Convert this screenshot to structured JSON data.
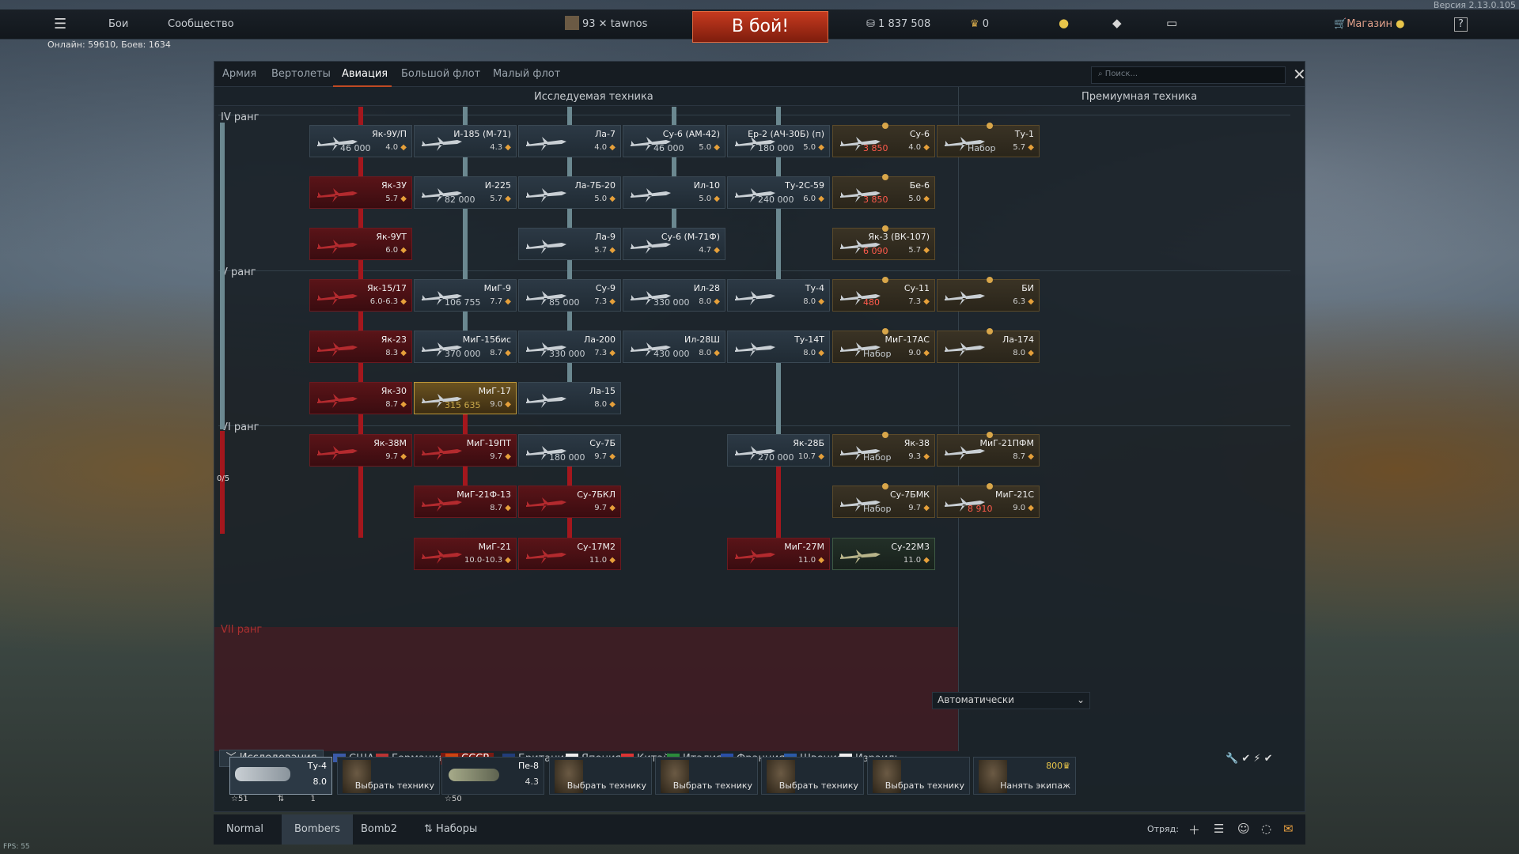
{
  "version": "Версия 2.13.0.105",
  "top": {
    "battles": "Бои",
    "community": "Сообщество",
    "level": "93",
    "player": "tawnos",
    "battle_btn": "В бой!",
    "silver": "1 837 508",
    "gold": "0",
    "shop": "Магазин",
    "help": "?"
  },
  "online": "Онлайн: 59610, Боев: 1634",
  "tabs": [
    "Армия",
    "Вертолеты",
    "Авиация",
    "Большой флот",
    "Малый флот"
  ],
  "search_placeholder": "Поиск...",
  "headers": {
    "research": "Исследуемая техника",
    "premium": "Премиумная техника"
  },
  "ranks": [
    "IV ранг",
    "V ранг",
    "VI ранг",
    "VII ранг"
  ],
  "rank_progress": "0/5",
  "cards": [
    {
      "n": "Як-9У/П",
      "rp": "46 000",
      "br": "4.0",
      "s": "std"
    },
    {
      "n": "И-185 (М-71)",
      "rp": "",
      "br": "4.3",
      "s": "std"
    },
    {
      "n": "Ла-7",
      "rp": "",
      "br": "4.0",
      "s": "std"
    },
    {
      "n": "Су-6 (АМ-42)",
      "rp": "46 000",
      "br": "5.0",
      "s": "std"
    },
    {
      "n": "Ер-2 (АЧ-30Б) (п)",
      "rp": "180 000",
      "br": "5.0",
      "s": "std"
    },
    {
      "n": "Як-3У",
      "rp": "",
      "br": "5.7",
      "s": "red"
    },
    {
      "n": "И-225",
      "rp": "82 000",
      "br": "5.7",
      "s": "std"
    },
    {
      "n": "Ла-7Б-20",
      "rp": "",
      "br": "5.0",
      "s": "std"
    },
    {
      "n": "Ил-10",
      "rp": "",
      "br": "5.0",
      "s": "std"
    },
    {
      "n": "Ту-2С-59",
      "rp": "240 000",
      "br": "6.0",
      "s": "std"
    },
    {
      "n": "Як-9УТ",
      "rp": "",
      "br": "6.0",
      "s": "red"
    },
    {
      "n": "Ла-9",
      "rp": "",
      "br": "5.7",
      "s": "std"
    },
    {
      "n": "Су-6 (М-71Ф)",
      "rp": "",
      "br": "4.7",
      "s": "std"
    },
    {
      "n": "Як-15/17",
      "rp": "",
      "br": "6.0-6.3",
      "s": "red"
    },
    {
      "n": "МиГ-9",
      "rp": "106 755",
      "br": "7.7",
      "s": "std"
    },
    {
      "n": "Су-9",
      "rp": "85 000",
      "br": "7.3",
      "s": "std"
    },
    {
      "n": "Ил-28",
      "rp": "330 000",
      "br": "8.0",
      "s": "std"
    },
    {
      "n": "Ту-4",
      "rp": "",
      "br": "8.0",
      "s": "std"
    },
    {
      "n": "Як-23",
      "rp": "",
      "br": "8.3",
      "s": "red"
    },
    {
      "n": "МиГ-15бис",
      "rp": "370 000",
      "br": "8.7",
      "s": "std"
    },
    {
      "n": "Ла-200",
      "rp": "330 000",
      "br": "7.3",
      "s": "std"
    },
    {
      "n": "Ил-28Ш",
      "rp": "430 000",
      "br": "8.0",
      "s": "std"
    },
    {
      "n": "Ту-14Т",
      "rp": "",
      "br": "8.0",
      "s": "std"
    },
    {
      "n": "Як-30",
      "rp": "",
      "br": "8.7",
      "s": "red"
    },
    {
      "n": "МиГ-17",
      "rp": "315 635",
      "br": "9.0",
      "s": "gold"
    },
    {
      "n": "Ла-15",
      "rp": "",
      "br": "8.0",
      "s": "std"
    },
    {
      "n": "Як-38М",
      "rp": "",
      "br": "9.7",
      "s": "red"
    },
    {
      "n": "МиГ-19ПТ",
      "rp": "",
      "br": "9.7",
      "s": "red"
    },
    {
      "n": "Су-7Б",
      "rp": "180 000",
      "br": "9.7",
      "s": "std"
    },
    {
      "n": "Як-28Б",
      "rp": "270 000",
      "br": "10.7",
      "s": "std"
    },
    {
      "n": "МиГ-21Ф-13",
      "rp": "",
      "br": "8.7",
      "s": "red"
    },
    {
      "n": "Су-7БКЛ",
      "rp": "",
      "br": "9.7",
      "s": "red"
    },
    {
      "n": "МиГ-21",
      "rp": "",
      "br": "10.0-10.3",
      "s": "red"
    },
    {
      "n": "Су-17М2",
      "rp": "",
      "br": "11.0",
      "s": "red"
    },
    {
      "n": "МиГ-27М",
      "rp": "",
      "br": "11.0",
      "s": "red"
    },
    {
      "n": "Су-6",
      "rp": "3 850",
      "br": "4.0",
      "s": "prem"
    },
    {
      "n": "Ту-1",
      "rp": "Набор",
      "br": "5.7",
      "s": "prem"
    },
    {
      "n": "Бе-6",
      "rp": "3 850",
      "br": "5.0",
      "s": "prem"
    },
    {
      "n": "Як-3 (ВК-107)",
      "rp": "6 090",
      "br": "5.7",
      "s": "prem"
    },
    {
      "n": "Су-11",
      "rp": "480",
      "br": "7.3",
      "s": "prem"
    },
    {
      "n": "БИ",
      "rp": "",
      "br": "6.3",
      "s": "prem"
    },
    {
      "n": "МиГ-17АС",
      "rp": "Набор",
      "br": "9.0",
      "s": "prem"
    },
    {
      "n": "Ла-174",
      "rp": "",
      "br": "8.0",
      "s": "prem"
    },
    {
      "n": "Як-38",
      "rp": "Набор",
      "br": "9.3",
      "s": "prem"
    },
    {
      "n": "МиГ-21ПФМ",
      "rp": "",
      "br": "8.7",
      "s": "prem"
    },
    {
      "n": "Су-7БМК",
      "rp": "Набор",
      "br": "9.7",
      "s": "prem"
    },
    {
      "n": "МиГ-21С",
      "rp": "8 910",
      "br": "9.0",
      "s": "prem"
    },
    {
      "n": "Су-22М3",
      "rp": "",
      "br": "11.0",
      "s": "gift"
    }
  ],
  "bottom": {
    "research": "Исследования",
    "auto": "Автоматически"
  },
  "nations": [
    "США",
    "Германия",
    "СССР",
    "Британия",
    "Япония",
    "Китай",
    "Италия",
    "Франция",
    "Швеция",
    "Израиль"
  ],
  "crew": {
    "t1": "Ту-4",
    "t1br": "8.0",
    "t1a": "51",
    "t1b": "1",
    "t2": "Пе-8",
    "t2br": "4.3",
    "t2a": "50",
    "choose": "Выбрать технику",
    "hire": "Нанять экипаж",
    "hire_cost": "800"
  },
  "presets": [
    "Normal",
    "Bombers",
    "Bomb2",
    "Наборы"
  ],
  "squad": "Отряд:",
  "fps": "FPS: 55"
}
